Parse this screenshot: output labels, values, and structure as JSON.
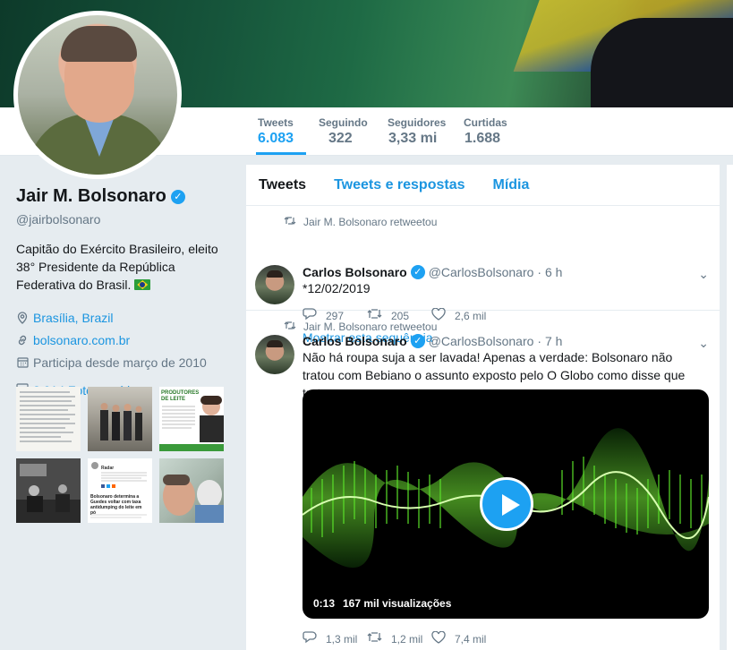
{
  "profile": {
    "name": "Jair M. Bolsonaro",
    "handle": "@jairbolsonaro",
    "bio": "Capitão do Exército Brasileiro, eleito 38° Presidente da República Federativa do Brasil.",
    "location": "Brasília, Brazil",
    "website": "bolsonaro.com.br",
    "joined": "Participa desde março de 2010",
    "photos_label": "2.014 Fotos e vídeos"
  },
  "stats": [
    {
      "label": "Tweets",
      "value": "6.083",
      "active": true
    },
    {
      "label": "Seguindo",
      "value": "322"
    },
    {
      "label": "Seguidores",
      "value": "3,33 mi"
    },
    {
      "label": "Curtidas",
      "value": "1.688"
    }
  ],
  "tabs": [
    {
      "label": "Tweets",
      "active": true
    },
    {
      "label": "Tweets e respostas"
    },
    {
      "label": "Mídia"
    }
  ],
  "thumbs": {
    "t3_heading": "PRODUTORES DE LEITE",
    "t5_title": "Bolsonaro determina a Guedes voltar com taxa antidumping do leite em pó",
    "t5_source": "Radar"
  },
  "tweets": [
    {
      "retweet_label": "Jair M. Bolsonaro retweetou",
      "name": "Carlos Bolsonaro",
      "handle": "@CarlosBolsonaro",
      "time": "· 6 h",
      "text": "*12/02/2019",
      "replies": "297",
      "retweets": "205",
      "likes": "2,6 mil",
      "show_thread": "Mostrar esta sequência"
    },
    {
      "retweet_label": "Jair M. Bolsonaro retweetou",
      "name": "Carlos Bolsonaro",
      "handle": "@CarlosBolsonaro",
      "time": "· 7 h",
      "text": "Não há roupa suja a ser lavada! Apenas a verdade: Bolsonaro não tratou com Bebiano o assunto exposto pelo O Globo como disse que tratou:",
      "video_duration": "0:13",
      "video_views": "167 mil visualizações",
      "replies": "1,3 mil",
      "retweets": "1,2 mil",
      "likes": "7,4 mil"
    }
  ],
  "colors": {
    "accent": "#1da1f2",
    "link": "#1b95e0",
    "muted": "#657786",
    "background": "#e6ecf0"
  }
}
